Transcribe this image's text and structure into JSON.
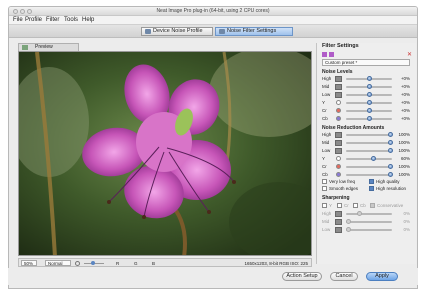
{
  "window": {
    "title": "Neat Image Pro plug-in (64-bit, using 2 CPU cores)"
  },
  "menu": [
    "File",
    "Profile",
    "Filter",
    "Tools",
    "Help"
  ],
  "modes": [
    {
      "label": "Device Noise Profile",
      "active": false
    },
    {
      "label": "Noise Filter Settings",
      "active": true
    }
  ],
  "preview_tab": {
    "label": "Preview"
  },
  "image_bar": {
    "zoom": "50%",
    "view_mode": "Normal",
    "channels": [
      "R",
      "G",
      "B"
    ],
    "info": "1650x1203, 8-bit RGB ISO: 225"
  },
  "panel": {
    "title": "Filter Settings",
    "preset": "Custom preset *",
    "noise_levels": {
      "title": "Noise Levels",
      "rows": [
        {
          "label": "High",
          "value": "+0%",
          "pos": 0.5
        },
        {
          "label": "Mid",
          "value": "+0%",
          "pos": 0.5
        },
        {
          "label": "Low",
          "value": "+0%",
          "pos": 0.5
        },
        {
          "label": "Y",
          "value": "+0%",
          "pos": 0.5,
          "dot": "#ffffff"
        },
        {
          "label": "Cr",
          "value": "+0%",
          "pos": 0.5,
          "dot": "#e66a5e"
        },
        {
          "label": "Cb",
          "value": "+0%",
          "pos": 0.5,
          "dot": "#8a7ad8"
        }
      ]
    },
    "noise_reduction": {
      "title": "Noise Reduction Amounts",
      "rows": [
        {
          "label": "High",
          "value": "100%",
          "pos": 1.0
        },
        {
          "label": "Mid",
          "value": "100%",
          "pos": 1.0
        },
        {
          "label": "Low",
          "value": "100%",
          "pos": 1.0
        },
        {
          "label": "Y",
          "value": "60%",
          "pos": 0.6,
          "dot": "#ffffff"
        },
        {
          "label": "Cr",
          "value": "100%",
          "pos": 1.0,
          "dot": "#e66a5e"
        },
        {
          "label": "Cb",
          "value": "100%",
          "pos": 1.0,
          "dot": "#8a7ad8"
        }
      ]
    },
    "options": [
      {
        "label": "Very low freq",
        "checked": false
      },
      {
        "label": "High quality",
        "checked": true
      },
      {
        "label": "Smooth edges",
        "checked": false
      },
      {
        "label": "High resolution",
        "checked": true
      }
    ],
    "sharpening": {
      "title": "Sharpening",
      "channels": [
        {
          "label": "Y",
          "checked": false
        },
        {
          "label": "Cr",
          "checked": false
        },
        {
          "label": "Cb",
          "checked": false
        },
        {
          "label": "Conservative",
          "checked": true
        }
      ],
      "rows": [
        {
          "label": "High",
          "value": "0%",
          "pos": 0.25
        },
        {
          "label": "Mid",
          "value": "0%",
          "pos": 0.0
        },
        {
          "label": "Low",
          "value": "0%",
          "pos": 0.0
        }
      ]
    }
  },
  "footer": {
    "action_setup": "Action Setup",
    "cancel": "Cancel",
    "apply": "Apply"
  }
}
